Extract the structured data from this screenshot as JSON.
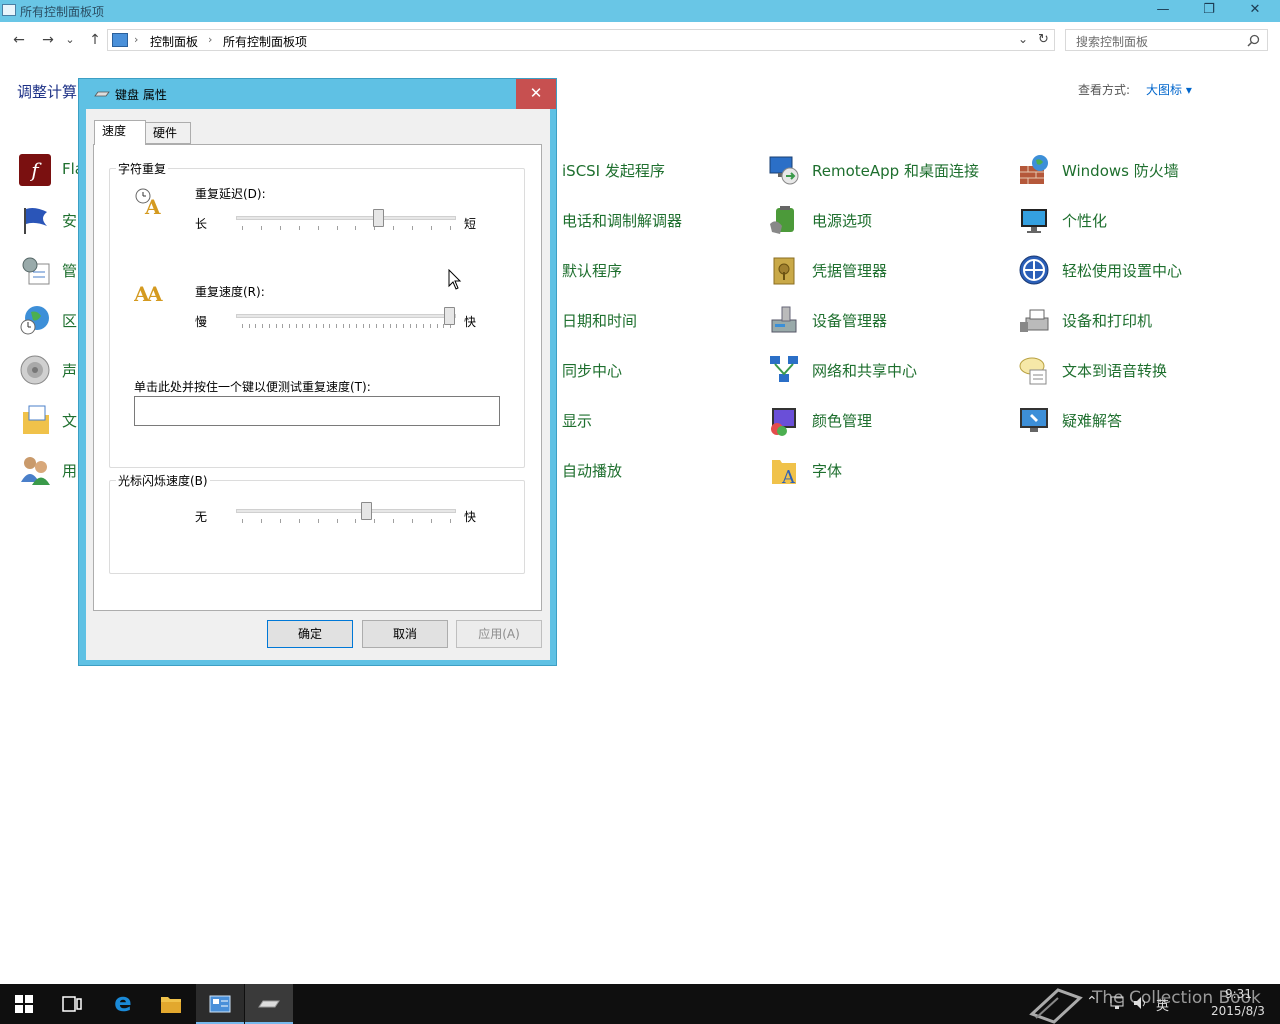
{
  "window": {
    "title": "所有控制面板项",
    "buttons": {
      "minimize": "—",
      "restore": "❐",
      "close": "✕"
    }
  },
  "nav": {
    "back": "←",
    "forward": "→",
    "recent": "⌄",
    "up": "↑",
    "breadcrumb": [
      "控制面板",
      "所有控制面板项"
    ],
    "breadcrumb_sep": "›",
    "dropdown": "⌄",
    "refresh": "↻",
    "search_placeholder": "搜索控制面板"
  },
  "header": {
    "title": "调整计算",
    "view_by_label": "查看方式:",
    "view_by_value": "大图标 ▾"
  },
  "left_items": [
    "Fla",
    "安",
    "管",
    "区",
    "声",
    "文",
    "用"
  ],
  "items": {
    "col1": [
      "iSCSI 发起程序",
      "电话和调制解调器",
      "默认程序",
      "日期和时间",
      "同步中心",
      "显示",
      "自动播放"
    ],
    "col2": [
      "RemoteApp 和桌面连接",
      "电源选项",
      "凭据管理器",
      "设备管理器",
      "网络和共享中心",
      "颜色管理",
      "字体"
    ],
    "col3": [
      "Windows 防火墙",
      "个性化",
      "轻松使用设置中心",
      "设备和打印机",
      "文本到语音转换",
      "疑难解答"
    ]
  },
  "dialog": {
    "title": "键盘 属性",
    "close": "✕",
    "tabs": [
      "速度",
      "硬件"
    ],
    "group1": {
      "label": "字符重复",
      "repeat_delay": {
        "label": "重复延迟(D):",
        "left": "长",
        "right": "短",
        "value": 0.66
      },
      "repeat_rate": {
        "label": "重复速度(R):",
        "left": "慢",
        "right": "快",
        "value": 1.0
      },
      "test_label": "单击此处并按住一个键以便测试重复速度(T):",
      "test_value": ""
    },
    "group2": {
      "label": "光标闪烁速度(B)",
      "blink": {
        "left": "无",
        "right": "快",
        "value": 0.6
      }
    },
    "buttons": {
      "ok": "确定",
      "cancel": "取消",
      "apply": "应用(A)"
    }
  },
  "taskbar": {
    "time": "9:31",
    "date": "2015/8/3",
    "ime": "英",
    "watermark": "The Collection Book"
  }
}
